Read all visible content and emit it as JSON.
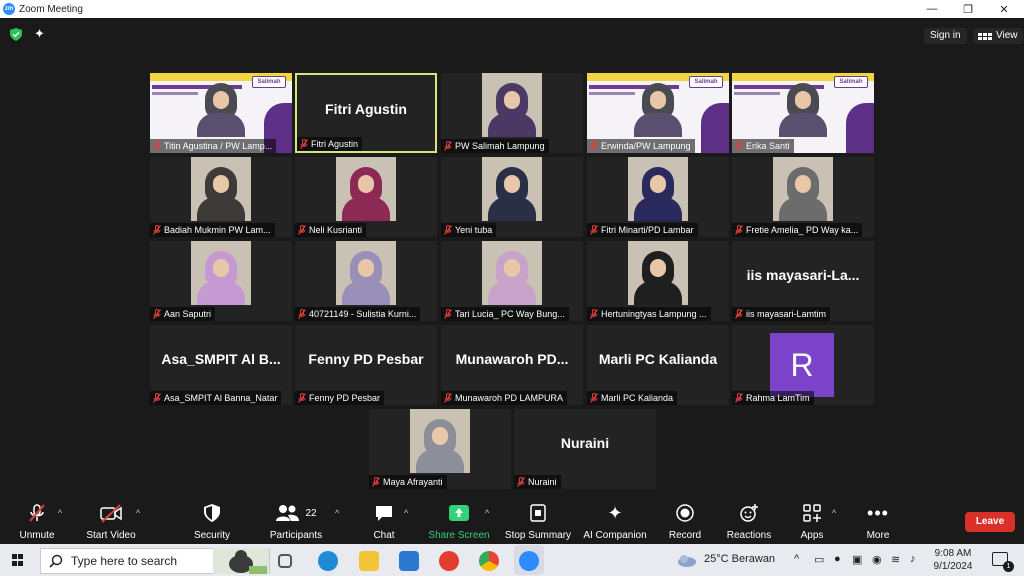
{
  "window": {
    "title": "Zoom Meeting",
    "app_icon": "zm",
    "controls": {
      "minimize": "—",
      "restore": "❐",
      "close": "✕"
    }
  },
  "topbar": {
    "sign_in": "Sign in",
    "view": "View"
  },
  "slide": {
    "logo": "Salimah"
  },
  "tiles": [
    {
      "name": "Titin Agustina / PW Lamp...",
      "kind": "slide"
    },
    {
      "name": "Fitri Agustin",
      "kind": "text",
      "big": "Fitri Agustin",
      "active": true
    },
    {
      "name": "PW Salimah Lampung",
      "kind": "photo",
      "scarf": "#4b3864"
    },
    {
      "name": "Erwinda/PW Lampung",
      "kind": "slide"
    },
    {
      "name": "Erika Santi",
      "kind": "slide"
    },
    {
      "name": "Badiah Mukmin PW Lam...",
      "kind": "photo",
      "scarf": "#3d3a38"
    },
    {
      "name": "Neli Kusrianti",
      "kind": "photo",
      "scarf": "#8c2a55"
    },
    {
      "name": "Yeni tuba",
      "kind": "photo",
      "scarf": "#2a2f46"
    },
    {
      "name": "Fitri Minarti/PD Lambar",
      "kind": "photo",
      "scarf": "#2b2a5e"
    },
    {
      "name": "Fretie Amelia_ PD Way ka...",
      "kind": "photo",
      "scarf": "#6c6c6c"
    },
    {
      "name": "Aan Saputri",
      "kind": "photo",
      "scarf": "#c59ad3"
    },
    {
      "name": "40721149 - Sulistia Kurni...",
      "kind": "photo",
      "scarf": "#9a8fb8"
    },
    {
      "name": "Tari Lucia_ PC Way Bung...",
      "kind": "photo",
      "scarf": "#c7a2c9"
    },
    {
      "name": "Hertuningtyas Lampung ...",
      "kind": "photo",
      "scarf": "#1f1f1f"
    },
    {
      "name": "iis mayasari-Lamtim",
      "kind": "text",
      "big": "iis mayasari-La..."
    },
    {
      "name": "Asa_SMPIT Al Banna_Natar",
      "kind": "text",
      "big": "Asa_SMPIT Al B..."
    },
    {
      "name": "Fenny PD Pesbar",
      "kind": "text",
      "big": "Fenny PD Pesbar"
    },
    {
      "name": "Munawaroh PD LAMPURA",
      "kind": "text",
      "big": "Munawaroh PD..."
    },
    {
      "name": "Marli PC Kalianda",
      "kind": "text",
      "big": "Marli PC Kalianda"
    },
    {
      "name": "Rahma LamTim",
      "kind": "avatar",
      "letter": "R"
    },
    {
      "name": "Maya Afrayanti",
      "kind": "photo",
      "scarf": "#8c8f9a"
    },
    {
      "name": "Nuraini",
      "kind": "text",
      "big": "Nuraini"
    }
  ],
  "toolbar": {
    "unmute": "Unmute",
    "start_video": "Start Video",
    "security": "Security",
    "participants": "Participants",
    "participants_count": "22",
    "chat": "Chat",
    "share_screen": "Share Screen",
    "stop_summary": "Stop Summary",
    "ai_companion": "AI Companion",
    "record": "Record",
    "reactions": "Reactions",
    "apps": "Apps",
    "more": "More",
    "leave": "Leave"
  },
  "taskbar": {
    "search_placeholder": "Type here to search",
    "weather": "25°C Berawan",
    "time": "9:08 AM",
    "date": "9/1/2024",
    "notification_count": "1"
  },
  "colors": {
    "accent": "#2d8cff",
    "leave": "#d9302a",
    "share_green": "#32d17a",
    "active_border": "#d7e37c"
  }
}
